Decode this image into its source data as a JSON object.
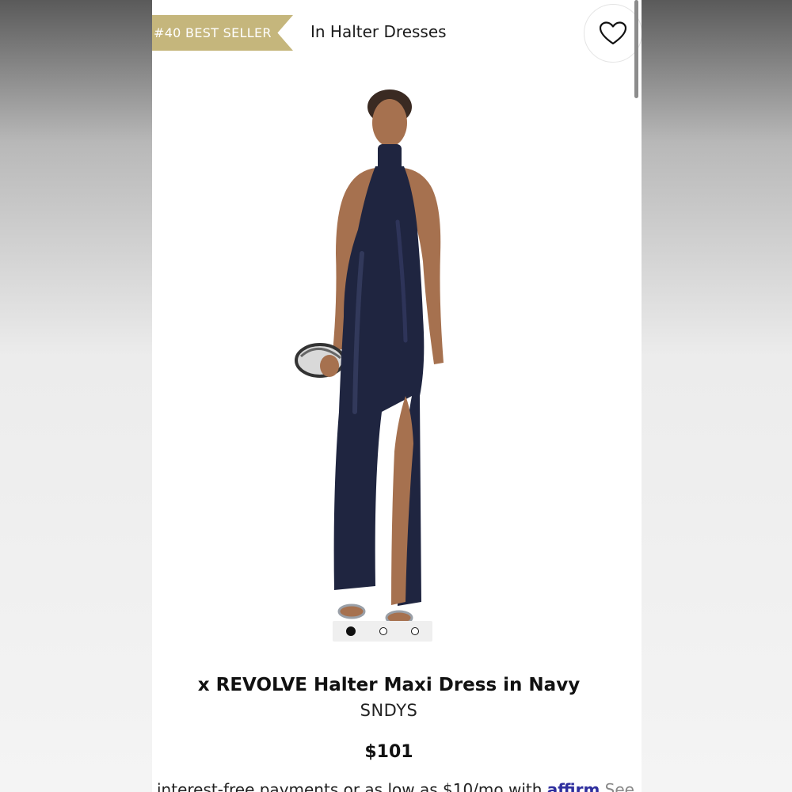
{
  "header": {
    "badge": "#40 BEST SELLER",
    "category": "In Halter Dresses"
  },
  "icons": {
    "favorite": "heart-icon"
  },
  "gallery": {
    "image_alt": "Model wearing navy halter maxi dress",
    "slide_count": 3,
    "active_slide": 1
  },
  "product": {
    "title": "x REVOLVE Halter Maxi Dress in Navy",
    "brand": "SNDYS",
    "price": "$101"
  },
  "financing": {
    "text": "interest-free payments or as low as $10/mo with",
    "provider": "affirm",
    "link": "See"
  },
  "colors": {
    "badge": "#c5b67c",
    "dress": "#1f2540"
  }
}
